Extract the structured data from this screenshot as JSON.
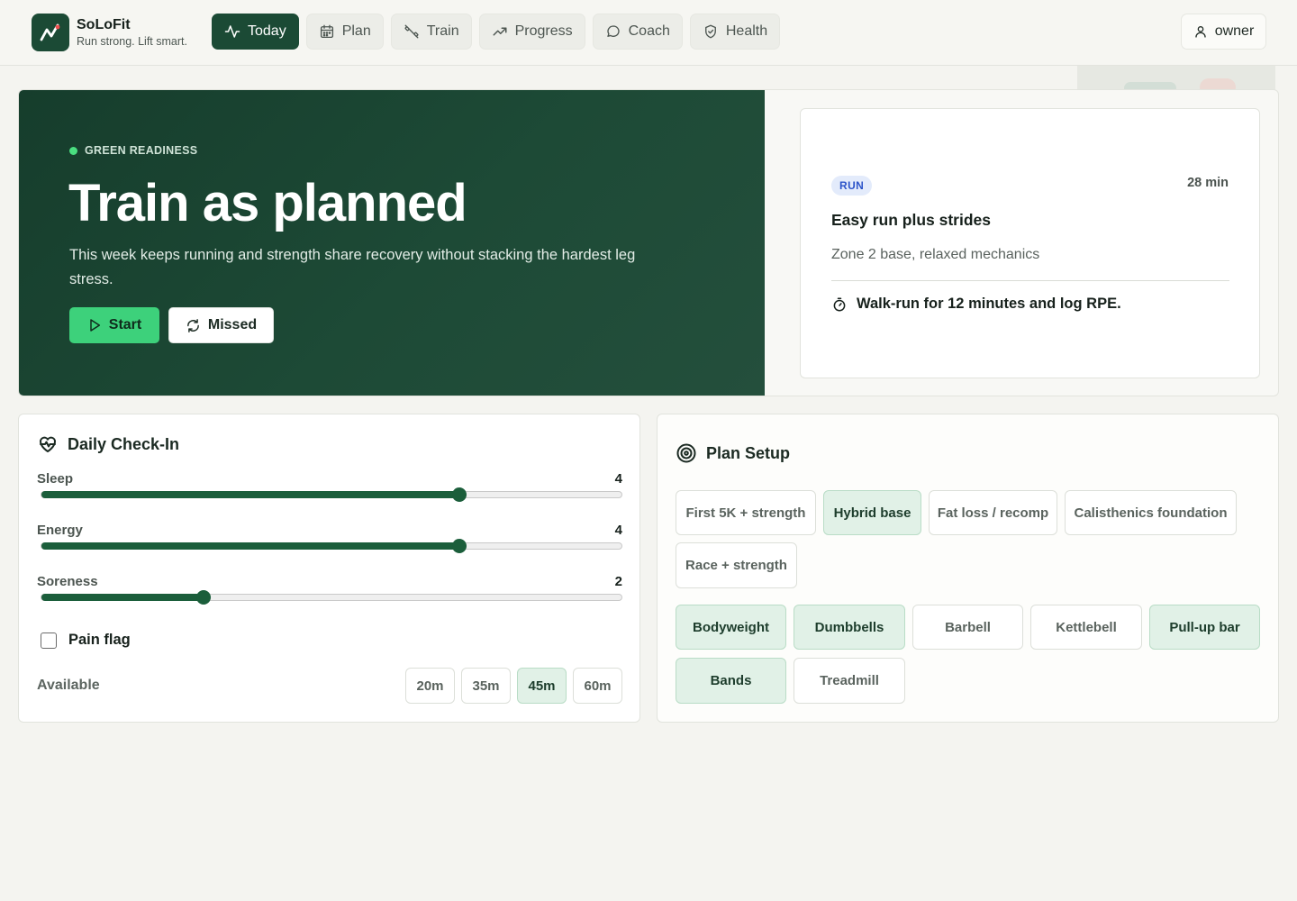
{
  "app": {
    "name": "SoLoFit",
    "tagline": "Run strong. Lift smart."
  },
  "nav": {
    "items": [
      {
        "label": "Today",
        "icon": "pulse-icon",
        "active": true
      },
      {
        "label": "Plan",
        "icon": "calendar-icon",
        "active": false
      },
      {
        "label": "Train",
        "icon": "dumbbell-icon",
        "active": false
      },
      {
        "label": "Progress",
        "icon": "trend-up-icon",
        "active": false
      },
      {
        "label": "Coach",
        "icon": "chat-bubble-icon",
        "active": false
      },
      {
        "label": "Health",
        "icon": "shield-icon",
        "active": false
      }
    ]
  },
  "user": {
    "label": "owner"
  },
  "hero": {
    "readiness": "GREEN READINESS",
    "title": "Train as planned",
    "description": "This week keeps running and strength share recovery without stacking the hardest leg stress.",
    "start_label": "Start",
    "missed_label": "Missed"
  },
  "session": {
    "type": "RUN",
    "duration": "28 min",
    "title": "Easy run plus strides",
    "subtitle": "Zone 2 base, relaxed mechanics",
    "note": "Walk-run for 12 minutes and log RPE."
  },
  "checkin": {
    "title": "Daily Check-In",
    "sliders": [
      {
        "label": "Sleep",
        "value": 4,
        "max": 5
      },
      {
        "label": "Energy",
        "value": 4,
        "max": 5
      },
      {
        "label": "Soreness",
        "value": 2,
        "max": 5
      }
    ],
    "pain_label": "Pain flag",
    "pain_checked": false,
    "available_label": "Available",
    "available_options": [
      "20m",
      "35m",
      "45m",
      "60m"
    ],
    "available_selected": "45m"
  },
  "plan_setup": {
    "title": "Plan Setup",
    "goals": [
      "First 5K + strength",
      "Hybrid base",
      "Fat loss / recomp",
      "Calisthenics foundation",
      "Race + strength"
    ],
    "goal_selected": "Hybrid base",
    "equipment": [
      "Bodyweight",
      "Dumbbells",
      "Barbell",
      "Kettlebell",
      "Pull-up bar",
      "Bands",
      "Treadmill"
    ],
    "equipment_selected": [
      "Bodyweight",
      "Dumbbells",
      "Pull-up bar",
      "Bands"
    ]
  },
  "colors": {
    "brand": "#1b4a35",
    "accent": "#3dd17b",
    "selected_bg": "#e1f1e7",
    "run_badge": "#2c54c9"
  }
}
